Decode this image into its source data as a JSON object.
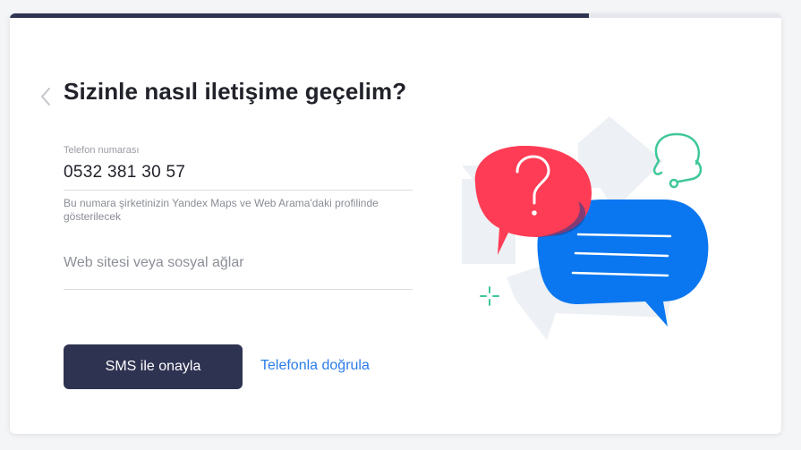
{
  "progress": {
    "fraction": 0.75
  },
  "header": {
    "back_icon": "chevron-left-icon",
    "title": "Sizinle nasıl iletişime geçelim?"
  },
  "phone": {
    "label": "Telefon numarası",
    "value": "0532 381 30 57",
    "hint": "Bu numara şirketinizin Yandex Maps ve Web Arama'daki profilinde gösterilecek"
  },
  "website": {
    "placeholder": "Web sitesi veya sosyal ağlar",
    "value": ""
  },
  "actions": {
    "sms_label": "SMS ile onayla",
    "phone_link_label": "Telefonla doğrula"
  },
  "illustration": {
    "icons": [
      "question-bubble-icon",
      "message-bubble-icon",
      "headset-icon",
      "sparkle-icon"
    ]
  },
  "colors": {
    "primary": "#2f3352",
    "link": "#2b7de9",
    "red_bubble": "#ff3c55",
    "blue_bubble": "#0a77f0",
    "teal": "#3ec79a"
  }
}
